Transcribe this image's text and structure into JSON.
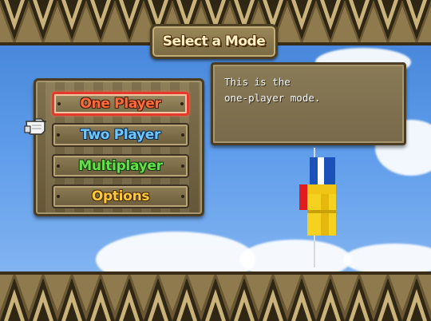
{
  "title": "Select a Mode",
  "menu": {
    "items": [
      {
        "label": "One Player",
        "selected": true,
        "color": "#ff6a3c"
      },
      {
        "label": "Two Player",
        "selected": false,
        "color": "#6ec8ff"
      },
      {
        "label": "Multiplayer",
        "selected": false,
        "color": "#64e04a"
      },
      {
        "label": "Options",
        "selected": false,
        "color": "#ffc83a"
      }
    ],
    "selection_color": "#e53a2b"
  },
  "description": "This is the\none-player mode.",
  "cursor_icon": "pointing-glove-icon"
}
